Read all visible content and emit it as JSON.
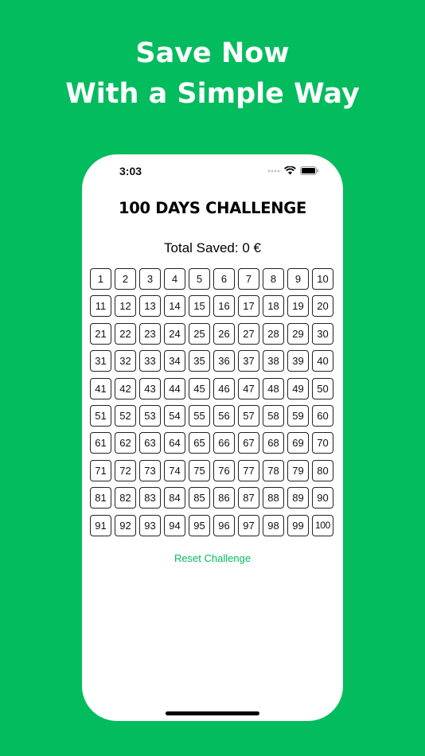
{
  "promo": {
    "line1": "Save Now",
    "line2": "With a Simple Way"
  },
  "status_bar": {
    "time": "3:03",
    "icons": [
      "signal-icon",
      "wifi-icon",
      "battery-icon"
    ]
  },
  "app": {
    "title": "100 DAYS CHALLENGE",
    "total_saved": "Total Saved: 0 €",
    "reset_label": "Reset Challenge"
  },
  "days": [
    "1",
    "2",
    "3",
    "4",
    "5",
    "6",
    "7",
    "8",
    "9",
    "10",
    "11",
    "12",
    "13",
    "14",
    "15",
    "16",
    "17",
    "18",
    "19",
    "20",
    "21",
    "22",
    "23",
    "24",
    "25",
    "26",
    "27",
    "28",
    "29",
    "30",
    "31",
    "32",
    "33",
    "34",
    "35",
    "36",
    "37",
    "38",
    "39",
    "40",
    "41",
    "42",
    "43",
    "44",
    "45",
    "46",
    "47",
    "48",
    "49",
    "50",
    "51",
    "52",
    "53",
    "54",
    "55",
    "56",
    "57",
    "58",
    "59",
    "60",
    "61",
    "62",
    "63",
    "64",
    "65",
    "66",
    "67",
    "68",
    "69",
    "70",
    "71",
    "72",
    "73",
    "74",
    "75",
    "76",
    "77",
    "78",
    "79",
    "80",
    "81",
    "82",
    "83",
    "84",
    "85",
    "86",
    "87",
    "88",
    "89",
    "90",
    "91",
    "92",
    "93",
    "94",
    "95",
    "96",
    "97",
    "98",
    "99",
    "100"
  ],
  "colors": {
    "background": "#03bc5d",
    "accent": "#03bc5d",
    "phone_surface": "#ffffff",
    "text": "#000000"
  }
}
